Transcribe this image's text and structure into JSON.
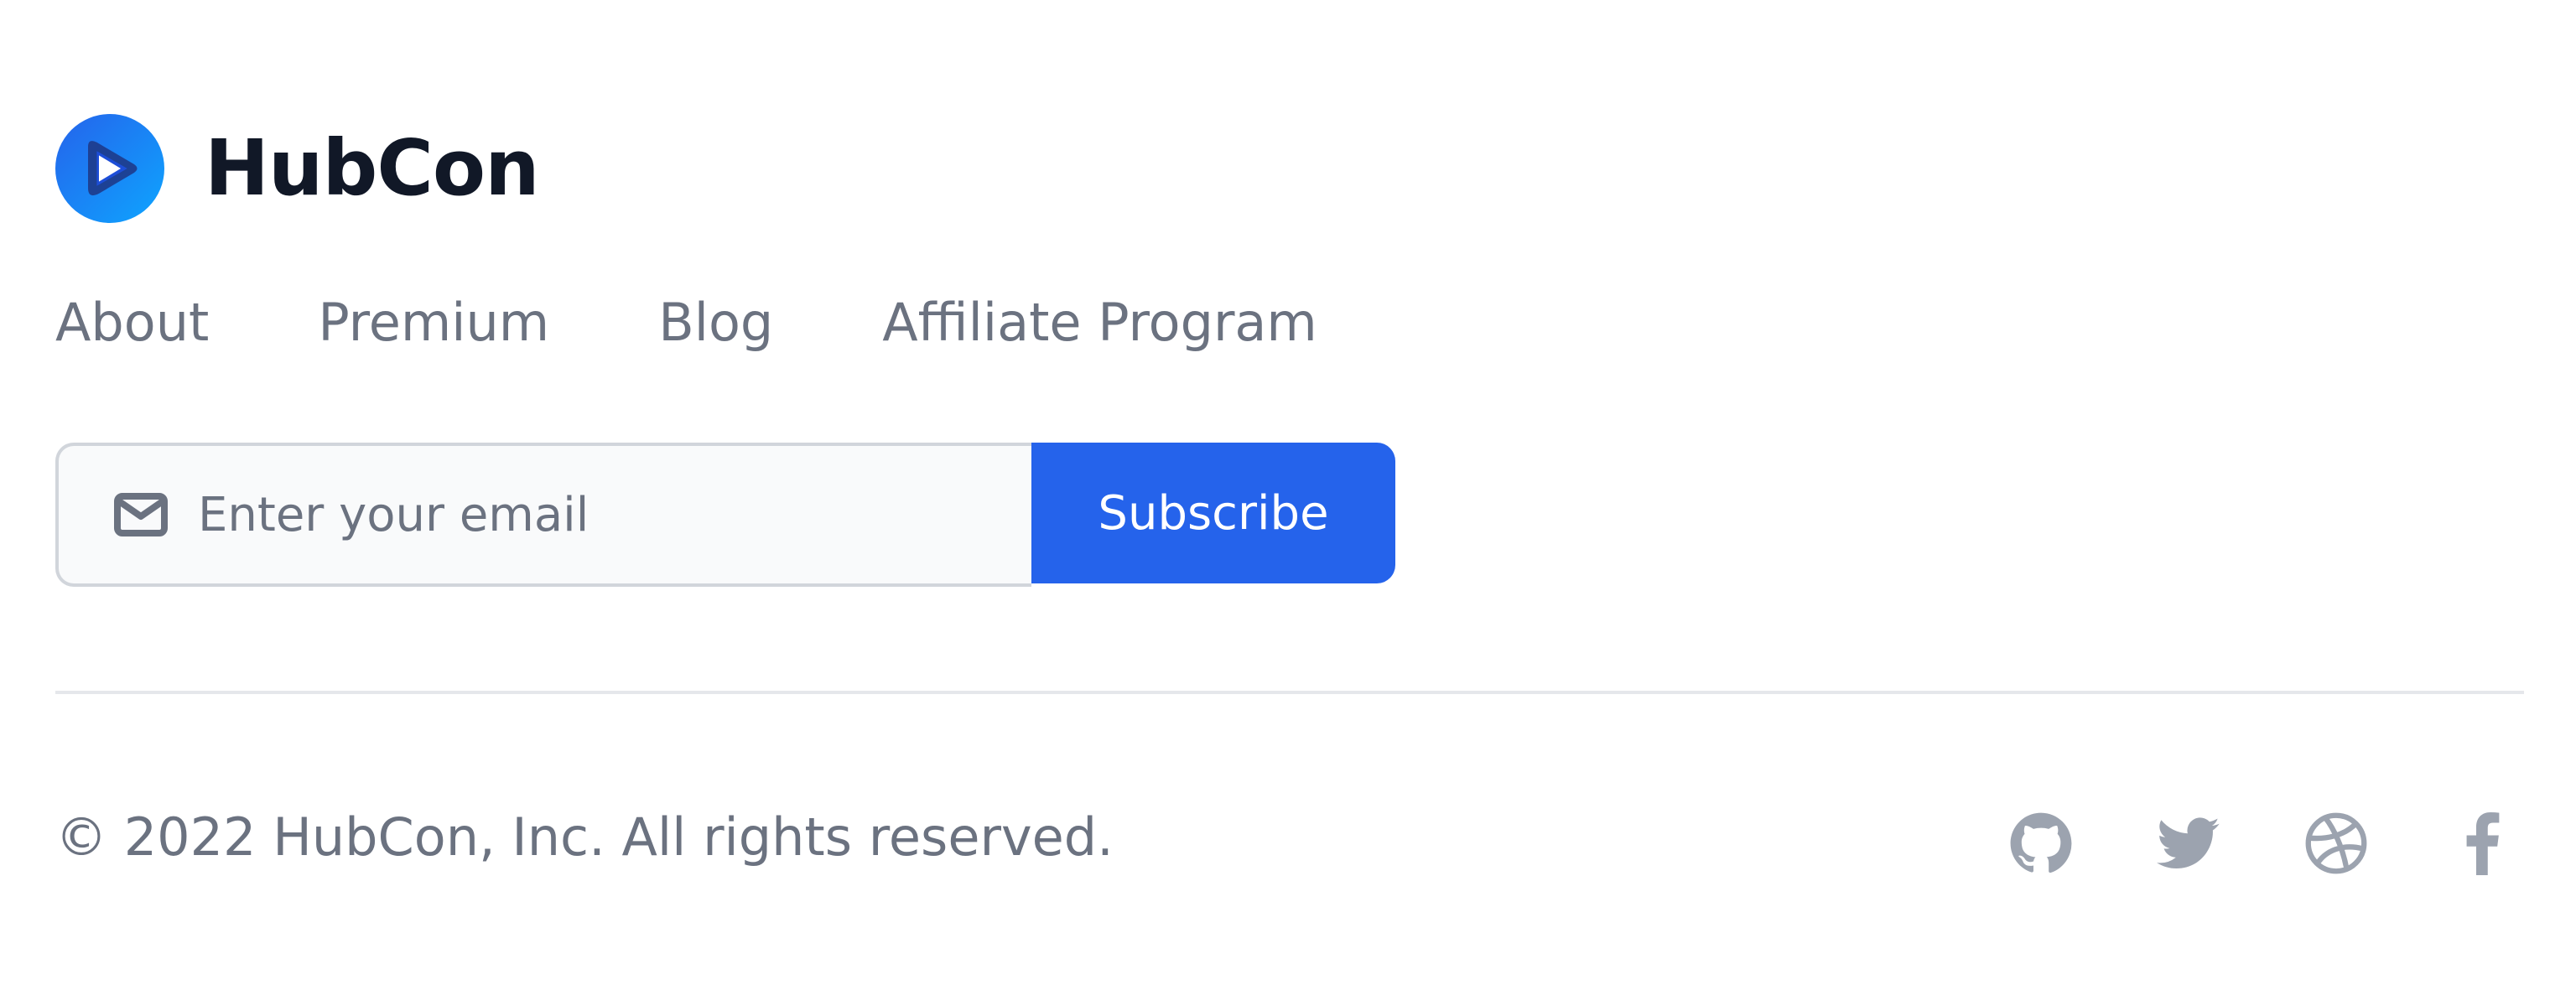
{
  "brand": {
    "name": "HubCon",
    "logo_icon": "play-logo-icon",
    "colors": {
      "logo_light": "#0ea5ff",
      "logo_dark": "#1d4ed8"
    }
  },
  "nav": {
    "links": [
      {
        "label": "About"
      },
      {
        "label": "Premium"
      },
      {
        "label": "Blog"
      },
      {
        "label": "Affiliate Program"
      }
    ]
  },
  "newsletter": {
    "icon": "mail-icon",
    "placeholder": "Enter your email",
    "value": "",
    "button_label": "Subscribe",
    "button_color": "#2563eb"
  },
  "footer": {
    "copyright": "© 2022 HubCon, Inc. All rights reserved.",
    "social": [
      {
        "name": "github-icon"
      },
      {
        "name": "twitter-icon"
      },
      {
        "name": "dribbble-icon"
      },
      {
        "name": "facebook-icon"
      }
    ],
    "icon_color": "#9ca3af",
    "text_color": "#6b7280"
  }
}
